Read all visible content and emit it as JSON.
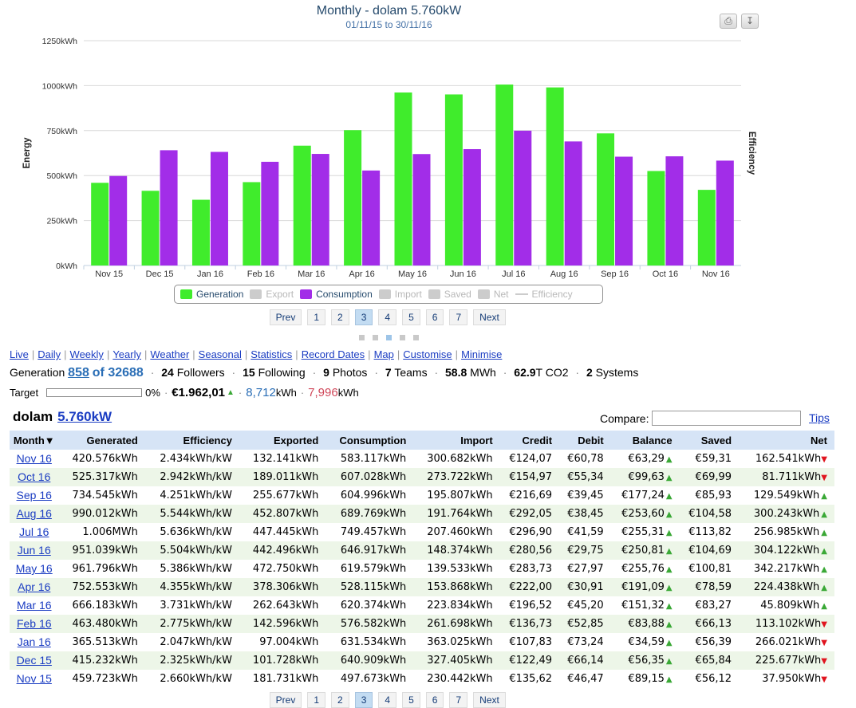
{
  "chart": {
    "title": "Monthly - dolam 5.760kW",
    "subtitle": "01/11/15 to 30/11/16"
  },
  "toolbar": {
    "print_icon": "printer-icon",
    "export_icon": "download-icon"
  },
  "chart_data": {
    "type": "bar",
    "title": "Monthly - dolam 5.760kW",
    "subtitle": "01/11/15 to 30/11/16",
    "categories": [
      "Nov 15",
      "Dec 15",
      "Jan 16",
      "Feb 16",
      "Mar 16",
      "Apr 16",
      "May 16",
      "Jun 16",
      "Jul 16",
      "Aug 16",
      "Sep 16",
      "Oct 16",
      "Nov 16"
    ],
    "series": [
      {
        "name": "Generation",
        "color": "#40ec2c",
        "values": [
          459.723,
          415.232,
          365.513,
          463.48,
          666.183,
          752.553,
          961.796,
          951.039,
          1006,
          990.012,
          734.545,
          525.317,
          420.576
        ]
      },
      {
        "name": "Consumption",
        "color": "#a22de8",
        "values": [
          497.673,
          640.909,
          631.534,
          576.582,
          620.374,
          528.115,
          619.579,
          646.917,
          749.457,
          689.769,
          604.996,
          607.028,
          583.117
        ]
      }
    ],
    "ylabel": "Energy",
    "y2label": "Efficiency",
    "yticks": [
      "0kWh",
      "250kWh",
      "500kWh",
      "750kWh",
      "1000kWh",
      "1250kWh"
    ],
    "ylim": [
      0,
      1250
    ],
    "grid": true,
    "legend_position": "bottom-center"
  },
  "legend": [
    {
      "label": "Generation",
      "color": "#40ec2c",
      "active": true,
      "kind": "box"
    },
    {
      "label": "Export",
      "color": "#cccccc",
      "active": false,
      "kind": "box"
    },
    {
      "label": "Consumption",
      "color": "#a22de8",
      "active": true,
      "kind": "box"
    },
    {
      "label": "Import",
      "color": "#cccccc",
      "active": false,
      "kind": "box"
    },
    {
      "label": "Saved",
      "color": "#cccccc",
      "active": false,
      "kind": "box"
    },
    {
      "label": "Net",
      "color": "#cccccc",
      "active": false,
      "kind": "box"
    },
    {
      "label": "Efficiency",
      "color": "#cccccc",
      "active": false,
      "kind": "line"
    }
  ],
  "pager": {
    "prev": "Prev",
    "next": "Next",
    "pages": [
      "1",
      "2",
      "3",
      "4",
      "5",
      "6",
      "7"
    ],
    "active": "3"
  },
  "nav_links": [
    "Live",
    "Daily",
    "Weekly",
    "Yearly",
    "Weather",
    "Seasonal",
    "Statistics",
    "Record Dates",
    "Map",
    "Customise",
    "Minimise"
  ],
  "generation": {
    "label": "Generation",
    "rank": "858",
    "of_label": "of 32688",
    "followers_num": "24",
    "followers_label": "Followers",
    "following_num": "15",
    "following_label": "Following",
    "photos_num": "9",
    "photos_label": "Photos",
    "teams_num": "7",
    "teams_label": "Teams",
    "mwh_num": "58.8",
    "mwh_label": "MWh",
    "co2_num": "62.9",
    "co2_label": "T CO2",
    "systems_num": "2",
    "systems_label": "Systems"
  },
  "target": {
    "label": "Target",
    "percent": "0%",
    "progress_fraction": 0.0,
    "money": "€1.962,01",
    "blue_value": "8,712",
    "blue_unit": "kWh",
    "red_value": "7,996",
    "red_unit": "kWh"
  },
  "system": {
    "name": "dolam",
    "size": "5.760kW"
  },
  "compare": {
    "label": "Compare:",
    "value": ""
  },
  "tips_label": "Tips",
  "table": {
    "headers": [
      "Month▼",
      "Generated",
      "Efficiency",
      "Exported",
      "Consumption",
      "Import",
      "Credit",
      "Debit",
      "Balance",
      "Saved",
      "Net"
    ],
    "rows": [
      [
        "Nov 16",
        "420.576kWh",
        "2.434kWh/kW",
        "132.141kWh",
        "583.117kWh",
        "300.682kWh",
        "€124,07",
        "€60,78",
        "€63,29",
        "up",
        "€59,31",
        "162.541kWh",
        "down"
      ],
      [
        "Oct 16",
        "525.317kWh",
        "2.942kWh/kW",
        "189.011kWh",
        "607.028kWh",
        "273.722kWh",
        "€154,97",
        "€55,34",
        "€99,63",
        "up",
        "€69,99",
        "81.711kWh",
        "down"
      ],
      [
        "Sep 16",
        "734.545kWh",
        "4.251kWh/kW",
        "255.677kWh",
        "604.996kWh",
        "195.807kWh",
        "€216,69",
        "€39,45",
        "€177,24",
        "up",
        "€85,93",
        "129.549kWh",
        "up"
      ],
      [
        "Aug 16",
        "990.012kWh",
        "5.544kWh/kW",
        "452.807kWh",
        "689.769kWh",
        "191.764kWh",
        "€292,05",
        "€38,45",
        "€253,60",
        "up",
        "€104,58",
        "300.243kWh",
        "up"
      ],
      [
        "Jul 16",
        "1.006MWh",
        "5.636kWh/kW",
        "447.445kWh",
        "749.457kWh",
        "207.460kWh",
        "€296,90",
        "€41,59",
        "€255,31",
        "up",
        "€113,82",
        "256.985kWh",
        "up"
      ],
      [
        "Jun 16",
        "951.039kWh",
        "5.504kWh/kW",
        "442.496kWh",
        "646.917kWh",
        "148.374kWh",
        "€280,56",
        "€29,75",
        "€250,81",
        "up",
        "€104,69",
        "304.122kWh",
        "up"
      ],
      [
        "May 16",
        "961.796kWh",
        "5.386kWh/kW",
        "472.750kWh",
        "619.579kWh",
        "139.533kWh",
        "€283,73",
        "€27,97",
        "€255,76",
        "up",
        "€100,81",
        "342.217kWh",
        "up"
      ],
      [
        "Apr 16",
        "752.553kWh",
        "4.355kWh/kW",
        "378.306kWh",
        "528.115kWh",
        "153.868kWh",
        "€222,00",
        "€30,91",
        "€191,09",
        "up",
        "€78,59",
        "224.438kWh",
        "up"
      ],
      [
        "Mar 16",
        "666.183kWh",
        "3.731kWh/kW",
        "262.643kWh",
        "620.374kWh",
        "223.834kWh",
        "€196,52",
        "€45,20",
        "€151,32",
        "up",
        "€83,27",
        "45.809kWh",
        "up"
      ],
      [
        "Feb 16",
        "463.480kWh",
        "2.775kWh/kW",
        "142.596kWh",
        "576.582kWh",
        "261.698kWh",
        "€136,73",
        "€52,85",
        "€83,88",
        "up",
        "€66,13",
        "113.102kWh",
        "down"
      ],
      [
        "Jan 16",
        "365.513kWh",
        "2.047kWh/kW",
        "97.004kWh",
        "631.534kWh",
        "363.025kWh",
        "€107,83",
        "€73,24",
        "€34,59",
        "up",
        "€56,39",
        "266.021kWh",
        "down"
      ],
      [
        "Dec 15",
        "415.232kWh",
        "2.325kWh/kW",
        "101.728kWh",
        "640.909kWh",
        "327.405kWh",
        "€122,49",
        "€66,14",
        "€56,35",
        "up",
        "€65,84",
        "225.677kWh",
        "down"
      ],
      [
        "Nov 15",
        "459.723kWh",
        "2.660kWh/kW",
        "181.731kWh",
        "497.673kWh",
        "230.442kWh",
        "€135,62",
        "€46,47",
        "€89,15",
        "up",
        "€56,12",
        "37.950kWh",
        "down"
      ]
    ]
  }
}
